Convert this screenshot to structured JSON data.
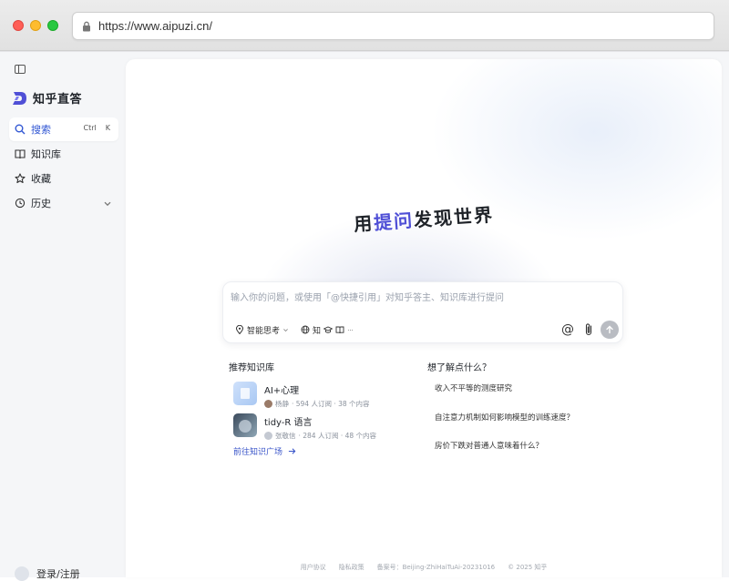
{
  "browser": {
    "url": "https://www.aipuzi.cn/"
  },
  "sidebar": {
    "logo_text": "知乎直答",
    "items": [
      {
        "label": "搜索",
        "icon": "search-icon",
        "shortcut": [
          "Ctrl",
          "K"
        ]
      },
      {
        "label": "知识库",
        "icon": "book-icon"
      },
      {
        "label": "收藏",
        "icon": "star-icon"
      },
      {
        "label": "历史",
        "icon": "history-icon"
      }
    ],
    "login": "登录/注册"
  },
  "hero": {
    "prefix": "用",
    "accent": "提问",
    "suffix": "发现世界"
  },
  "search": {
    "placeholder": "输入你的问题，或使用「@快捷引用」对知乎答主、知识库进行提问",
    "think_label": "智能思考",
    "sources_label": "知"
  },
  "recommended": {
    "title": "推荐知识库",
    "items": [
      {
        "name": "AI+心理",
        "author": "杨静",
        "meta": "· 594 人订阅 · 38 个内容"
      },
      {
        "name": "tidy-R 语言",
        "author": "张敬信",
        "meta": "· 284 人订阅 · 48 个内容"
      }
    ],
    "more": "前往知识广场"
  },
  "questions": {
    "title": "想了解点什么？",
    "items": [
      "收入不平等的测度研究",
      "自注意力机制如何影响模型的训练速度？",
      "房价下跌对普通人意味着什么？"
    ]
  },
  "footer": [
    "用户协议",
    "隐私政策",
    "备案号：Beijing-ZhiHaiTuAi-20231016",
    "© 2025 知乎"
  ],
  "colors": {
    "accent": "#4f4fd6",
    "link": "#3a55c9"
  }
}
